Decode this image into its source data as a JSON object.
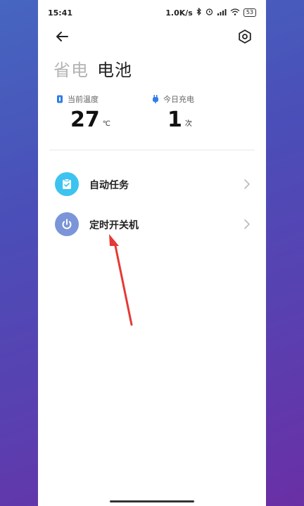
{
  "status_bar": {
    "time": "15:41",
    "speed": "1.0K/s",
    "battery": "53"
  },
  "header": {
    "tabs": [
      {
        "label": "省电",
        "active": false
      },
      {
        "label": "电池",
        "active": true
      }
    ]
  },
  "stats": {
    "temperature": {
      "label": "当前温度",
      "value": "27",
      "unit": "℃"
    },
    "charge_count": {
      "label": "今日充电",
      "value": "1",
      "unit": "次"
    }
  },
  "menu": {
    "items": [
      {
        "label": "自动任务",
        "icon": "clipboard-icon",
        "icon_color": "#3cc3f0"
      },
      {
        "label": "定时开关机",
        "icon": "power-icon",
        "icon_color": "#7b95d8"
      }
    ]
  },
  "colors": {
    "annotation_arrow": "#e53935",
    "temp_icon": "#2f7de8",
    "charge_icon": "#2f7de8"
  }
}
